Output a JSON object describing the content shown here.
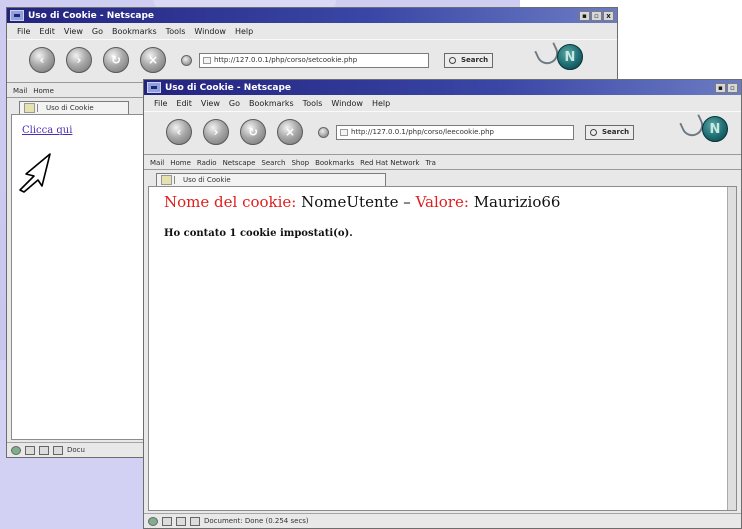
{
  "back_window": {
    "title": "Uso di Cookie - Netscape",
    "menu": [
      "File",
      "Edit",
      "View",
      "Go",
      "Bookmarks",
      "Tools",
      "Window",
      "Help"
    ],
    "url": "http://127.0.0.1/php/corso/setcookie.php",
    "search_label": "Search",
    "personal_bar": [
      "Mail",
      "Home"
    ],
    "tab_label": "Uso di Cookie",
    "link_text": "Clicca qui",
    "status_text": "Docu"
  },
  "front_window": {
    "title": "Uso di Cookie - Netscape",
    "menu": [
      "File",
      "Edit",
      "View",
      "Go",
      "Bookmarks",
      "Tools",
      "Window",
      "Help"
    ],
    "url": "http://127.0.0.1/php/corso/leecookie.php",
    "search_label": "Search",
    "personal_bar": [
      "Mail",
      "Home",
      "Radio",
      "Netscape",
      "Search",
      "Shop",
      "Bookmarks",
      "Red Hat Network",
      "Tra"
    ],
    "tab_label": "Uso di Cookie",
    "cookie_name_label": "Nome del cookie:",
    "cookie_name_value": "NomeUtente",
    "separator": "–",
    "cookie_value_label": "Valore:",
    "cookie_value_value": "Maurizio66",
    "count_text": "Ho contato 1 cookie impostati(o).",
    "status_text": "Document: Done (0.254 secs)"
  },
  "window_buttons": [
    "▪",
    "▫",
    "x"
  ],
  "colors": {
    "background_lavender": "#cfcdf1",
    "titlebar": "#23237e",
    "cookie_label_red": "#e11d1d",
    "link_purple": "#4b2eb3"
  },
  "icons": [
    "back-arrow-icon",
    "forward-arrow-icon",
    "reload-icon",
    "stop-icon",
    "netscape-logo-icon",
    "cursor-arrow-icon"
  ]
}
